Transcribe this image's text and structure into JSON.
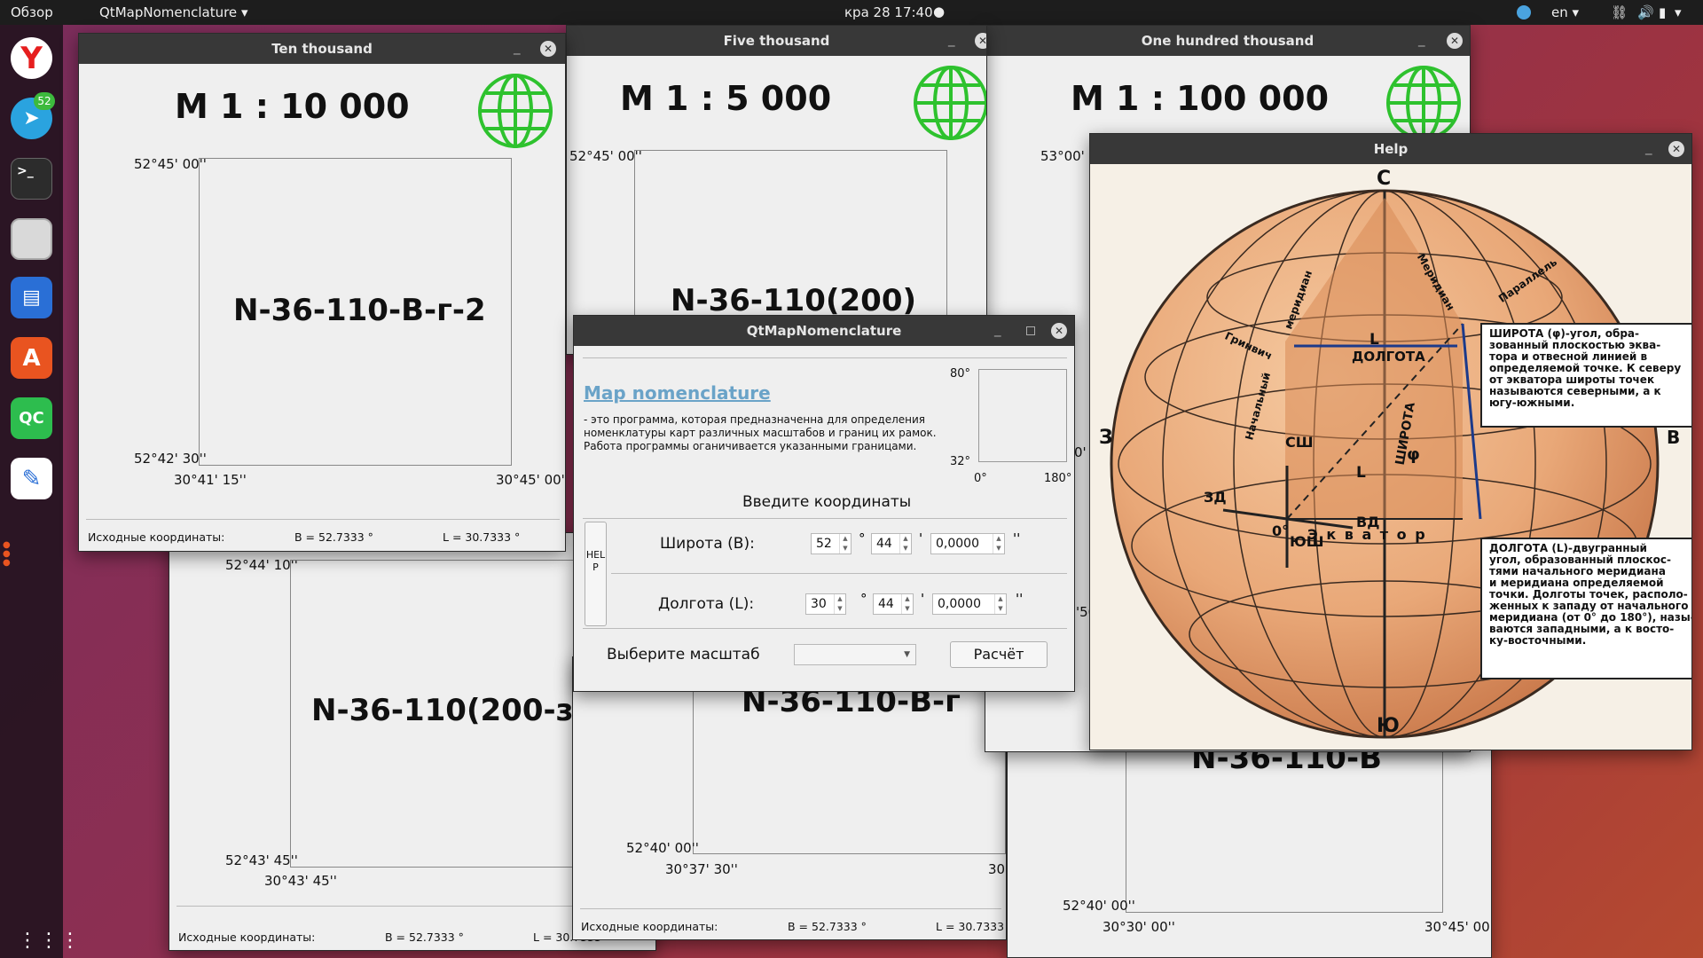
{
  "topbar": {
    "activities": "Обзор",
    "app_menu": "QtMapNomenclature",
    "datetime": "кра 28  17:40",
    "lang": "en"
  },
  "dock": {
    "telegram_badge": "52",
    "qc_label": "QC"
  },
  "win_ten": {
    "title": "Ten thousand",
    "scale": "М 1 : 10 000",
    "nomenclature": "N-36-110-В-г-2",
    "lat_top": "52°45' 00''",
    "lat_bottom": "52°42' 30''",
    "lon_left": "30°41' 15''",
    "lon_right": "30°45' 00''",
    "status_label": "Исходные координаты:",
    "status_b": "B = 52.7333 °",
    "status_l": "L = 30.7333 °"
  },
  "win_five": {
    "title": "Five thousand",
    "scale": "М 1 : 5 000",
    "nomenclature": "N-36-110(200)",
    "lat_top": "52°45' 00''"
  },
  "win_hundred": {
    "title": "One hundred thousand",
    "scale": "М 1 : 100 000",
    "lat_top": "53°00' 00''"
  },
  "win_bl": {
    "nomenclature": "N-36-110(200-з)",
    "lat_top": "52°44' 10''",
    "lat_bottom": "52°43' 45''",
    "lon_left": "30°43' 45''",
    "status_label": "Исходные координаты:",
    "status_b": "B = 52.7333 °",
    "status_l": "L = 30.7333 °"
  },
  "win_bm": {
    "nomenclature": "N-36-110-В-г",
    "lat_bottom": "52°40' 00''",
    "lon_left": "30°37' 30''",
    "lon_right": "30°",
    "status_label": "Исходные координаты:",
    "status_b": "B = 52.7333 °",
    "status_l": "L = 30.7333 °"
  },
  "win_br": {
    "nomenclature": "N-36-110-В",
    "lat_bottom": "52°40' 00''",
    "lon_left": "30°30' 00''",
    "lon_right": "30°45' 00''",
    "side_deg": "0'",
    "side_deg2": "'50"
  },
  "main": {
    "title": "QtMapNomenclature",
    "link": "Map nomenclature",
    "desc1": "- это программа, которая предназначенна для определения",
    "desc2": "номенклатуры карт различных масштабов и границ их рамок.",
    "desc3": "Работа программы оганичивается указанными границами.",
    "range_80": "80°",
    "range_32": "32°",
    "range_0": "0°",
    "range_180": "180°",
    "heading": "Введите координаты",
    "help_btn": "HELP",
    "lat_label": "Широта (B):",
    "lat_deg": "52",
    "lat_min": "44",
    "lat_sec": "0,0000",
    "lon_label": "Долгота (L):",
    "lon_deg": "30",
    "lon_min": "44",
    "lon_sec": "0,0000",
    "deg_sym": "°",
    "min_sym": "'",
    "sec_sym": "''",
    "scale_label": "Выберите масштаб",
    "scale_value": "",
    "calc_btn": "Расчёт"
  },
  "help": {
    "title": "Help",
    "north": "С",
    "south": "Ю",
    "west": "З",
    "east": "В",
    "sh": "СШ",
    "ysh": "ЮШ",
    "zd": "ЗД",
    "vd": "ВД",
    "zero": "0°",
    "dolgota": "ДОЛГОТА",
    "equator": "Э к в а т о р",
    "phi": "φ",
    "L1": "L",
    "L2": "L",
    "grinvich": "Гринвич",
    "meridian": "меридиан",
    "nachalny": "Начальный",
    "shirota": "ШИРОТА",
    "paralel": "Параллель",
    "meridian2": "Меридиан",
    "box1_1": "ШИРОТА (φ)-угол, обра-",
    "box1_2": "зованный плоскостью эква-",
    "box1_3": "тора и отвесной линией в",
    "box1_4": "определяемой точке. К северу",
    "box1_5": "от экватора широты точек",
    "box1_6": "называются северными, а к",
    "box1_7": "югу-южными.",
    "box2_1": "ДОЛГОТА (L)-двугранный",
    "box2_2": "угол, образованный плоскос-",
    "box2_3": "тями начального меридиана",
    "box2_4": "и меридиана определяемой",
    "box2_5": "точки. Долготы точек, располо-",
    "box2_6": "женных к западу от начального",
    "box2_7": "меридиана (от 0° до 180°), назы-",
    "box2_8": "ваются западными, а к восто-",
    "box2_9": "ку-восточными."
  },
  "colors": {
    "globe_green": "#2ec22e",
    "link": "#6aa3c8",
    "sphere": "#e9a878"
  }
}
